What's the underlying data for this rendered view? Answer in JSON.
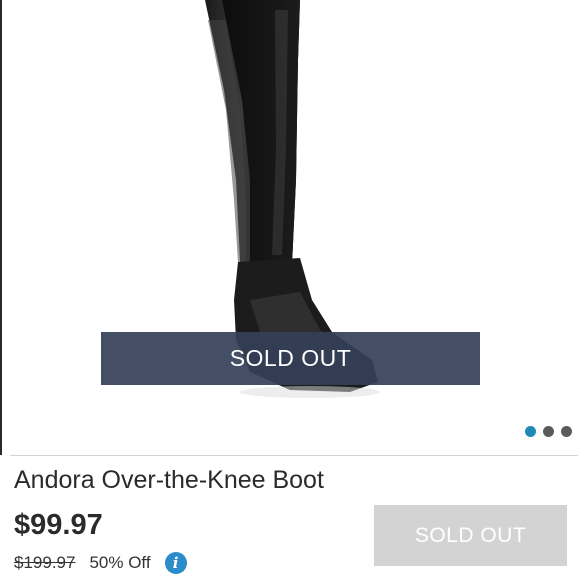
{
  "product": {
    "image_alt": "Black leather over-the-knee boot",
    "image_overlay_text": "SOLD OUT",
    "title": "Andora Over-the-Knee Boot",
    "price": "$99.97",
    "original_price": "$199.97",
    "discount": "50% Off",
    "info_icon": "info-icon",
    "cta_label": "SOLD OUT"
  },
  "carousel": {
    "dot_count": 3,
    "active_index": 0
  },
  "colors": {
    "banner": "#344058",
    "active_dot": "#1f8ab5",
    "inactive_dot": "#5b5b5b",
    "info": "#2b8cc9",
    "disabled_button": "#d3d3d3",
    "text": "#2b2b2b"
  }
}
